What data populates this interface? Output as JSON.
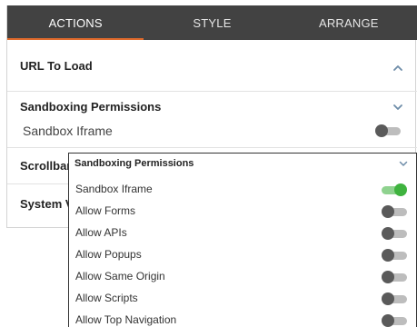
{
  "tabs": [
    {
      "label": "ACTIONS",
      "active": true
    },
    {
      "label": "STYLE",
      "active": false
    },
    {
      "label": "ARRANGE",
      "active": false
    }
  ],
  "panel": {
    "url_section": {
      "title": "URL To Load",
      "icon": "chevron-up-icon"
    },
    "sandbox_section": {
      "title": "Sandboxing Permissions",
      "icon": "chevron-down-icon",
      "sandbox_iframe_label": "Sandbox Iframe",
      "sandbox_iframe_on": false
    },
    "scrollbars_section": {
      "title": "Scrollbars"
    },
    "system_section": {
      "title": "System V"
    }
  },
  "popup": {
    "title": "Sandboxing Permissions",
    "icon": "chevron-down-icon",
    "items": [
      {
        "label": "Sandbox Iframe",
        "on": true
      },
      {
        "label": "Allow Forms",
        "on": false
      },
      {
        "label": "Allow APIs",
        "on": false
      },
      {
        "label": "Allow Popups",
        "on": false
      },
      {
        "label": "Allow Same Origin",
        "on": false
      },
      {
        "label": "Allow Scripts",
        "on": false
      },
      {
        "label": "Allow Top Navigation",
        "on": false
      }
    ]
  },
  "colors": {
    "tab_bar": "#424242",
    "tab_active_underline": "#e06b2c",
    "toggle_on": "#3fb33f",
    "toggle_off": "#5a5a5a",
    "chevron": "#6d8ca8"
  }
}
